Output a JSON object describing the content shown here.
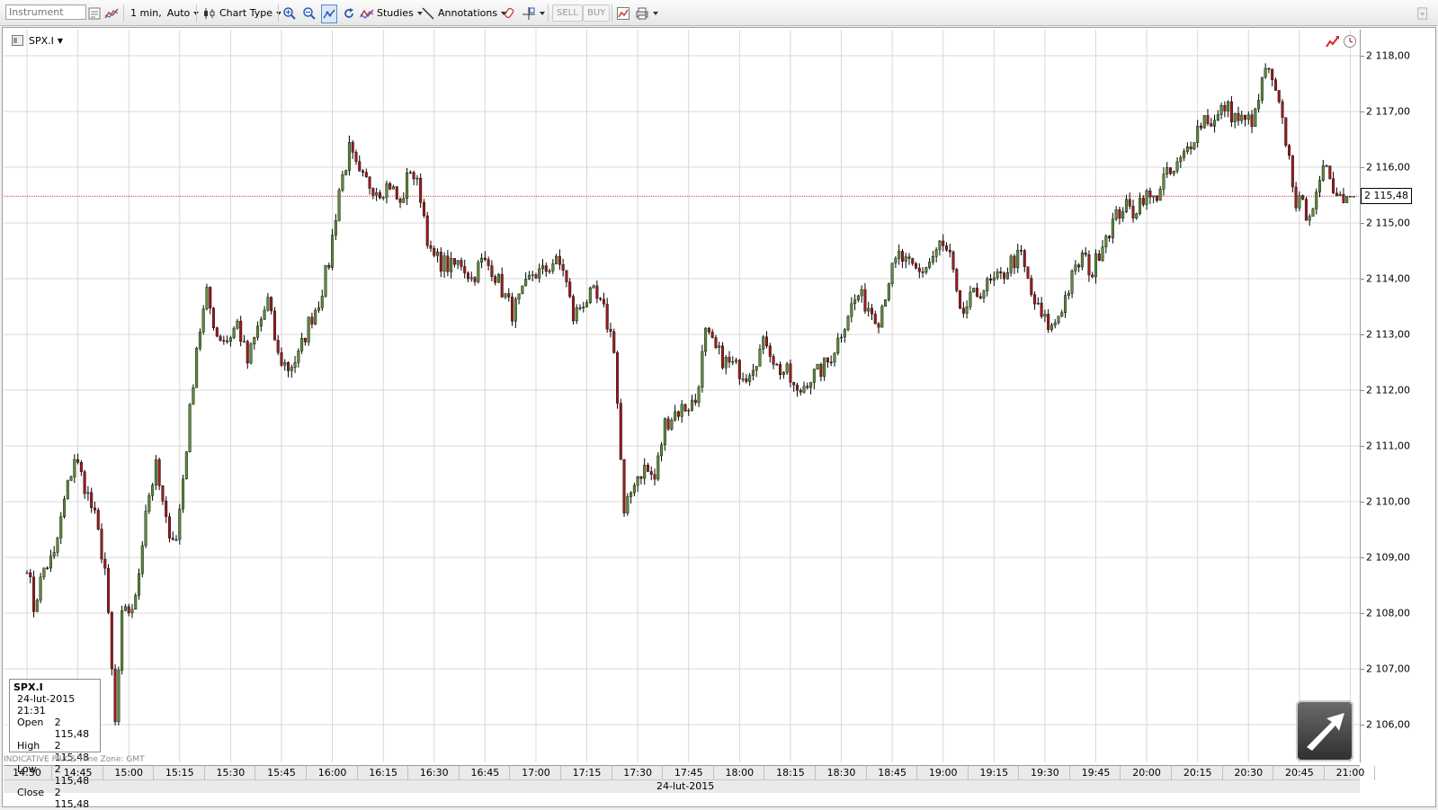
{
  "toolbar": {
    "instrument_placeholder": "Instrument",
    "interval_label": "1 min,",
    "auto_label": "Auto",
    "chart_type_label": "Chart Type",
    "studies_label": "Studies",
    "annotations_label": "Annotations",
    "sell_label": "SELL",
    "buy_label": "BUY"
  },
  "chart_header": {
    "instrument": "SPX.I"
  },
  "info_box": {
    "symbol": "SPX.I",
    "datetime": "24-lut-2015 21:31",
    "open_label": "Open",
    "open": "2 115,48",
    "high_label": "High",
    "high": "2 115,48",
    "low_label": "Low",
    "low": "2 115,48",
    "close_label": "Close",
    "close": "2 115,48"
  },
  "indicative": "INDICATIVE PRICE   Time Zone: GMT",
  "last_price": "2 115,48",
  "x_axis": {
    "date": "24-lut-2015",
    "labels": [
      "14:30",
      "14:45",
      "15:00",
      "15:15",
      "15:30",
      "15:45",
      "16:00",
      "16:15",
      "16:30",
      "16:45",
      "17:00",
      "17:15",
      "17:30",
      "17:45",
      "18:00",
      "18:15",
      "18:30",
      "18:45",
      "19:00",
      "19:15",
      "19:30",
      "19:45",
      "20:00",
      "20:15",
      "20:30",
      "20:45",
      "21:00"
    ]
  },
  "y_axis": {
    "labels": [
      "2 118,00",
      "2 117,00",
      "2 116,00",
      "2 115,00",
      "2 114,00",
      "2 113,00",
      "2 112,00",
      "2 111,00",
      "2 110,00",
      "2 109,00",
      "2 108,00",
      "2 107,00",
      "2 106,00"
    ],
    "values": [
      2118,
      2117,
      2116,
      2115,
      2114,
      2113,
      2112,
      2111,
      2110,
      2109,
      2108,
      2107,
      2106
    ]
  },
  "colors": {
    "up": "#5c8a3a",
    "down": "#9b1b1b",
    "grid": "#d8d8d8",
    "last_line": "#e03a3a"
  },
  "chart_data": {
    "type": "candlestick",
    "interval": "1 min",
    "ylim": [
      2105.3,
      2118.5
    ],
    "price_anchors": [
      [
        "14:30",
        2108.9
      ],
      [
        "14:32",
        2108.1
      ],
      [
        "14:35",
        2108.8
      ],
      [
        "14:38",
        2109.0
      ],
      [
        "14:41",
        2110.0
      ],
      [
        "14:44",
        2110.8
      ],
      [
        "14:47",
        2110.3
      ],
      [
        "14:50",
        2109.7
      ],
      [
        "14:53",
        2108.8
      ],
      [
        "14:56",
        2106.0
      ],
      [
        "14:58",
        2107.9
      ],
      [
        "15:02",
        2108.2
      ],
      [
        "15:05",
        2109.9
      ],
      [
        "15:08",
        2110.6
      ],
      [
        "15:11",
        2109.6
      ],
      [
        "15:14",
        2109.3
      ],
      [
        "15:17",
        2111.0
      ],
      [
        "15:20",
        2112.8
      ],
      [
        "15:23",
        2113.7
      ],
      [
        "15:26",
        2113.0
      ],
      [
        "15:29",
        2112.9
      ],
      [
        "15:32",
        2113.2
      ],
      [
        "15:35",
        2112.5
      ],
      [
        "15:38",
        2113.1
      ],
      [
        "15:41",
        2113.6
      ],
      [
        "15:44",
        2112.6
      ],
      [
        "15:47",
        2112.4
      ],
      [
        "15:50",
        2112.6
      ],
      [
        "15:53",
        2113.2
      ],
      [
        "15:56",
        2113.6
      ],
      [
        "15:59",
        2114.3
      ],
      [
        "16:02",
        2115.6
      ],
      [
        "16:05",
        2116.3
      ],
      [
        "16:08",
        2115.8
      ],
      [
        "16:11",
        2115.7
      ],
      [
        "16:14",
        2115.6
      ],
      [
        "16:17",
        2115.7
      ],
      [
        "16:20",
        2115.3
      ],
      [
        "16:23",
        2116.0
      ],
      [
        "16:26",
        2115.5
      ],
      [
        "16:29",
        2114.4
      ],
      [
        "16:32",
        2114.3
      ],
      [
        "16:35",
        2114.2
      ],
      [
        "16:38",
        2114.3
      ],
      [
        "16:41",
        2114.0
      ],
      [
        "16:44",
        2114.3
      ],
      [
        "16:47",
        2114.2
      ],
      [
        "16:50",
        2113.8
      ],
      [
        "16:53",
        2113.4
      ],
      [
        "16:56",
        2113.7
      ],
      [
        "16:59",
        2114.1
      ],
      [
        "17:02",
        2114.1
      ],
      [
        "17:05",
        2114.3
      ],
      [
        "17:08",
        2114.2
      ],
      [
        "17:11",
        2113.3
      ],
      [
        "17:14",
        2113.6
      ],
      [
        "17:17",
        2113.7
      ],
      [
        "17:20",
        2113.4
      ],
      [
        "17:23",
        2112.8
      ],
      [
        "17:26",
        2109.7
      ],
      [
        "17:29",
        2110.4
      ],
      [
        "17:32",
        2110.6
      ],
      [
        "17:35",
        2110.4
      ],
      [
        "17:38",
        2111.4
      ],
      [
        "17:41",
        2111.6
      ],
      [
        "17:44",
        2111.7
      ],
      [
        "17:47",
        2111.8
      ],
      [
        "17:50",
        2113.0
      ],
      [
        "17:53",
        2112.7
      ],
      [
        "17:56",
        2112.5
      ],
      [
        "17:59",
        2112.4
      ],
      [
        "18:02",
        2112.3
      ],
      [
        "18:05",
        2112.6
      ],
      [
        "18:08",
        2112.9
      ],
      [
        "18:11",
        2112.4
      ],
      [
        "18:14",
        2112.3
      ],
      [
        "18:17",
        2111.9
      ],
      [
        "18:20",
        2112.2
      ],
      [
        "18:23",
        2112.3
      ],
      [
        "18:26",
        2112.5
      ],
      [
        "18:29",
        2112.9
      ],
      [
        "18:32",
        2113.4
      ],
      [
        "18:35",
        2113.7
      ],
      [
        "18:38",
        2113.5
      ],
      [
        "18:41",
        2113.3
      ],
      [
        "18:44",
        2114.0
      ],
      [
        "18:47",
        2114.4
      ],
      [
        "18:50",
        2114.2
      ],
      [
        "18:53",
        2114.1
      ],
      [
        "18:56",
        2114.3
      ],
      [
        "18:59",
        2114.6
      ],
      [
        "19:02",
        2114.4
      ],
      [
        "19:05",
        2113.3
      ],
      [
        "19:08",
        2113.6
      ],
      [
        "19:11",
        2113.8
      ],
      [
        "19:14",
        2113.9
      ],
      [
        "19:17",
        2114.0
      ],
      [
        "19:20",
        2114.3
      ],
      [
        "19:23",
        2114.4
      ],
      [
        "19:26",
        2113.7
      ],
      [
        "19:29",
        2113.3
      ],
      [
        "19:32",
        2113.1
      ],
      [
        "19:35",
        2113.5
      ],
      [
        "19:38",
        2114.0
      ],
      [
        "19:41",
        2114.4
      ],
      [
        "19:44",
        2114.1
      ],
      [
        "19:47",
        2114.7
      ],
      [
        "19:50",
        2115.0
      ],
      [
        "19:53",
        2115.3
      ],
      [
        "19:56",
        2115.2
      ],
      [
        "19:59",
        2115.5
      ],
      [
        "20:02",
        2115.4
      ],
      [
        "20:05",
        2115.8
      ],
      [
        "20:08",
        2115.9
      ],
      [
        "20:11",
        2116.2
      ],
      [
        "20:14",
        2116.6
      ],
      [
        "20:17",
        2116.9
      ],
      [
        "20:20",
        2116.8
      ],
      [
        "20:23",
        2117.1
      ],
      [
        "20:26",
        2116.9
      ],
      [
        "20:29",
        2116.8
      ],
      [
        "20:32",
        2116.9
      ],
      [
        "20:35",
        2117.8
      ],
      [
        "20:38",
        2117.3
      ],
      [
        "20:41",
        2116.5
      ],
      [
        "20:44",
        2115.4
      ],
      [
        "20:47",
        2115.2
      ],
      [
        "20:50",
        2115.4
      ],
      [
        "20:53",
        2116.1
      ],
      [
        "20:56",
        2115.5
      ],
      [
        "20:59",
        2115.48
      ],
      [
        "21:01",
        2115.48
      ]
    ]
  }
}
